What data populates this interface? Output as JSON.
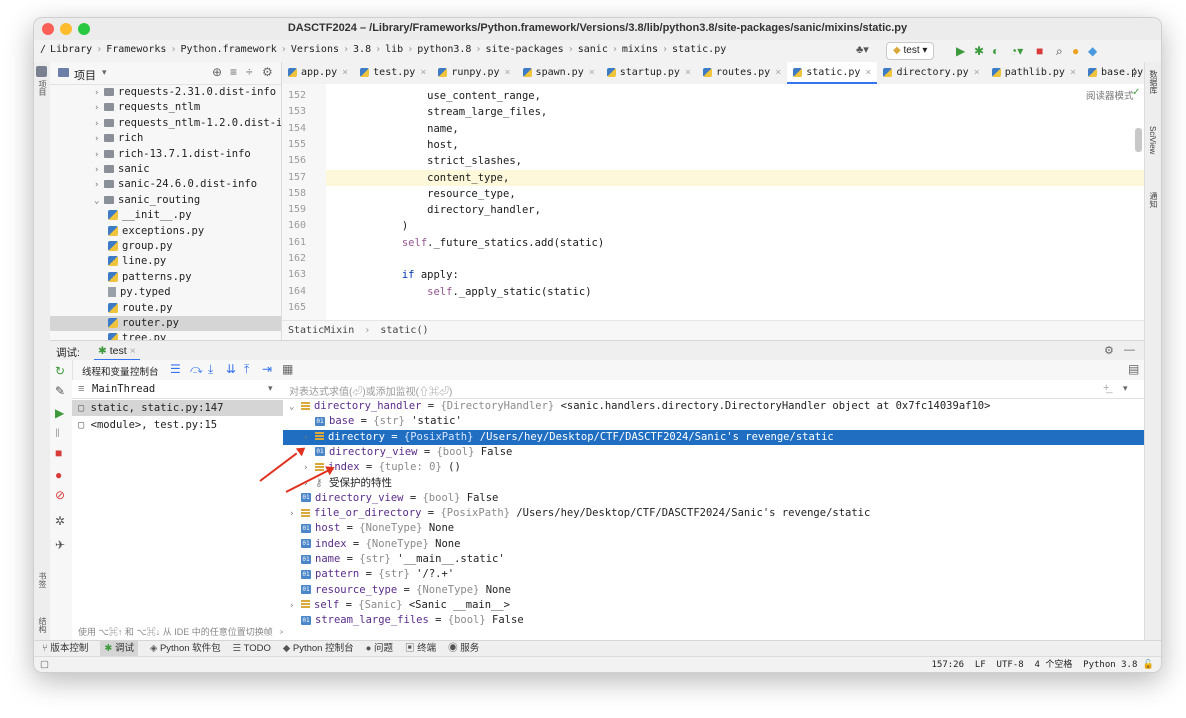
{
  "window": {
    "title": "DASCTF2024 – /Library/Frameworks/Python.framework/Versions/3.8/lib/python3.8/site-packages/sanic/mixins/static.py"
  },
  "nav": {
    "breadcrumbs": [
      "/",
      "Library",
      "Frameworks",
      "Python.framework",
      "Versions",
      "3.8",
      "lib",
      "python3.8",
      "site-packages",
      "sanic",
      "mixins",
      "static.py"
    ],
    "run_config": "test"
  },
  "project": {
    "header": "项目",
    "items": [
      {
        "label": "requests-2.31.0.dist-info",
        "kind": "folder",
        "indent": 1,
        "chevron": ">"
      },
      {
        "label": "requests_ntlm",
        "kind": "folder",
        "indent": 1,
        "chevron": ">"
      },
      {
        "label": "requests_ntlm-1.2.0.dist-i",
        "kind": "folder",
        "indent": 1,
        "chevron": ">"
      },
      {
        "label": "rich",
        "kind": "folder",
        "indent": 1,
        "chevron": ">"
      },
      {
        "label": "rich-13.7.1.dist-info",
        "kind": "folder",
        "indent": 1,
        "chevron": ">"
      },
      {
        "label": "sanic",
        "kind": "folder",
        "indent": 1,
        "chevron": ">"
      },
      {
        "label": "sanic-24.6.0.dist-info",
        "kind": "folder",
        "indent": 1,
        "chevron": ">"
      },
      {
        "label": "sanic_routing",
        "kind": "folder",
        "indent": 1,
        "chevron": "v"
      },
      {
        "label": "__init__.py",
        "kind": "py",
        "indent": 2,
        "chevron": ""
      },
      {
        "label": "exceptions.py",
        "kind": "py",
        "indent": 2,
        "chevron": ""
      },
      {
        "label": "group.py",
        "kind": "py",
        "indent": 2,
        "chevron": ""
      },
      {
        "label": "line.py",
        "kind": "py",
        "indent": 2,
        "chevron": ""
      },
      {
        "label": "patterns.py",
        "kind": "py",
        "indent": 2,
        "chevron": ""
      },
      {
        "label": "py.typed",
        "kind": "txt",
        "indent": 2,
        "chevron": ""
      },
      {
        "label": "route.py",
        "kind": "py",
        "indent": 2,
        "chevron": ""
      },
      {
        "label": "router.py",
        "kind": "py",
        "indent": 2,
        "chevron": "",
        "selected": true
      },
      {
        "label": "tree.py",
        "kind": "py",
        "indent": 2,
        "chevron": ""
      }
    ]
  },
  "editor": {
    "tabs": [
      "app.py",
      "test.py",
      "runpy.py",
      "spawn.py",
      "startup.py",
      "routes.py",
      "static.py",
      "directory.py",
      "pathlib.py",
      "base.py"
    ],
    "active_tab": "static.py",
    "reader_mode": "阅读器模式",
    "lines": [
      {
        "n": "152",
        "text": "                use_content_range,"
      },
      {
        "n": "153",
        "text": "                stream_large_files,"
      },
      {
        "n": "154",
        "text": "                name,"
      },
      {
        "n": "155",
        "text": "                host,"
      },
      {
        "n": "156",
        "text": "                strict_slashes,"
      },
      {
        "n": "157",
        "text": "                content_type,",
        "current": true
      },
      {
        "n": "158",
        "text": "                resource_type,"
      },
      {
        "n": "159",
        "text": "                directory_handler,"
      },
      {
        "n": "160",
        "text": "            )"
      },
      {
        "n": "161",
        "text": "            self._future_statics.add(static)"
      },
      {
        "n": "162",
        "text": ""
      },
      {
        "n": "163",
        "text": "            if apply:"
      },
      {
        "n": "164",
        "text": "                self._apply_static(static)"
      },
      {
        "n": "165",
        "text": ""
      }
    ],
    "breadcrumb": [
      "StaticMixin",
      "static()"
    ]
  },
  "debug": {
    "label": "调试:",
    "config_tab": "test",
    "subtabs": [
      "线程和变量",
      "控制台"
    ],
    "thread": "MainThread",
    "eval_placeholder": "对表达式求值(⏎)或添加监视(⇧⌘⏎)",
    "frames": [
      "static, static.py:147",
      "<module>, test.py:15"
    ],
    "frames_hint": "使用 ⌥⌘↑ 和 ⌥⌘↓ 从 IDE 中的任意位置切换帧",
    "variables": [
      {
        "indent": 0,
        "chevron": "v",
        "icon": "list",
        "name": "directory_handler",
        "type": "{DirectoryHandler}",
        "value": "<sanic.handlers.directory.DirectoryHandler object at 0x7fc14039af10>"
      },
      {
        "indent": 1,
        "chevron": "",
        "icon": "01",
        "name": "base",
        "type": "{str}",
        "value": "'static'"
      },
      {
        "indent": 1,
        "chevron": ">",
        "icon": "list",
        "name": "directory",
        "type": "{PosixPath}",
        "value": "/Users/hey/Desktop/CTF/DASCTF2024/Sanic's revenge/static",
        "selected": true
      },
      {
        "indent": 1,
        "chevron": "",
        "icon": "01",
        "name": "directory_view",
        "type": "{bool}",
        "value": "False"
      },
      {
        "indent": 1,
        "chevron": ">",
        "icon": "list",
        "name": "index",
        "type": "{tuple: 0}",
        "value": "()"
      },
      {
        "indent": 1,
        "chevron": ">",
        "icon": "key",
        "name": "受保护的特性",
        "type": "",
        "value": ""
      },
      {
        "indent": 0,
        "chevron": "",
        "icon": "01",
        "name": "directory_view",
        "type": "{bool}",
        "value": "False"
      },
      {
        "indent": 0,
        "chevron": ">",
        "icon": "list",
        "name": "file_or_directory",
        "type": "{PosixPath}",
        "value": "/Users/hey/Desktop/CTF/DASCTF2024/Sanic's revenge/static"
      },
      {
        "indent": 0,
        "chevron": "",
        "icon": "01",
        "name": "host",
        "type": "{NoneType}",
        "value": "None"
      },
      {
        "indent": 0,
        "chevron": "",
        "icon": "01",
        "name": "index",
        "type": "{NoneType}",
        "value": "None"
      },
      {
        "indent": 0,
        "chevron": "",
        "icon": "01",
        "name": "name",
        "type": "{str}",
        "value": "'__main__.static'"
      },
      {
        "indent": 0,
        "chevron": "",
        "icon": "01",
        "name": "pattern",
        "type": "{str}",
        "value": "'/?.+'"
      },
      {
        "indent": 0,
        "chevron": "",
        "icon": "01",
        "name": "resource_type",
        "type": "{NoneType}",
        "value": "None"
      },
      {
        "indent": 0,
        "chevron": ">",
        "icon": "list",
        "name": "self",
        "type": "{Sanic}",
        "value": "<Sanic __main__>"
      },
      {
        "indent": 0,
        "chevron": "",
        "icon": "01",
        "name": "stream_large_files",
        "type": "{bool}",
        "value": "False"
      }
    ]
  },
  "toolwindows": [
    "版本控制",
    "调试",
    "Python 软件包",
    "TODO",
    "Python 控制台",
    "问题",
    "终端",
    "服务"
  ],
  "status": {
    "position": "157:26",
    "line_sep": "LF",
    "encoding": "UTF-8",
    "indent": "4 个空格",
    "interpreter": "Python 3.8"
  },
  "right_strip": [
    "数据库",
    "SciView",
    "通知"
  ],
  "left_strip": [
    "项目",
    "书签",
    "结构"
  ],
  "colors": {
    "accent": "#3574f0",
    "selection": "#1f6ec2",
    "arrow": "#e0301e"
  }
}
